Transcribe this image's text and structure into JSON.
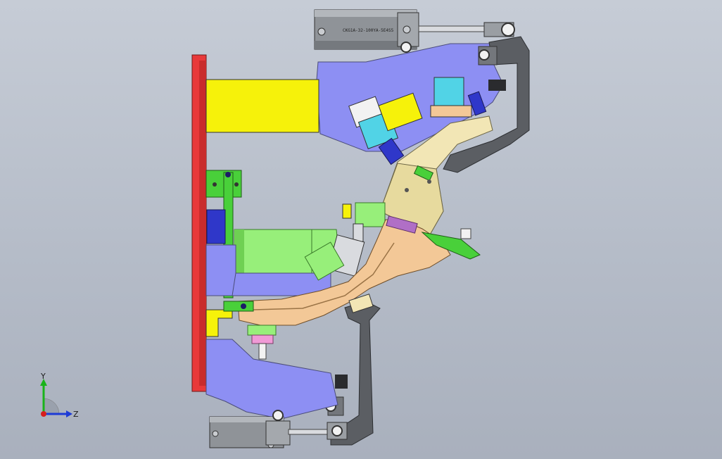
{
  "viewport": {
    "background_colors": [
      "#c6ccd6",
      "#a9b0bd"
    ]
  },
  "cylinders": {
    "top_label": "CKG1A-32-100YA-5E4S5",
    "bottom_label": ""
  },
  "colors": {
    "base_plate": "#e8393a",
    "support_block": "#f6f20a",
    "bracket": "#8d8ff3",
    "arm": "#5b5e63",
    "cylinder_body": "#8f9398",
    "clamp_block": "#51d3e6",
    "locator_pin": "#2f37c9",
    "green_part": "#49d03a",
    "light_green": "#97ef7a",
    "workpiece": "#f3c897",
    "pad": "#f09ad6",
    "tan_part": "#f2e6b5"
  },
  "triad": {
    "y_label": "Y",
    "z_label": "Z",
    "y_color": "#1ab31a",
    "z_color": "#1e3bd6",
    "x_color": "#d61e1e"
  }
}
